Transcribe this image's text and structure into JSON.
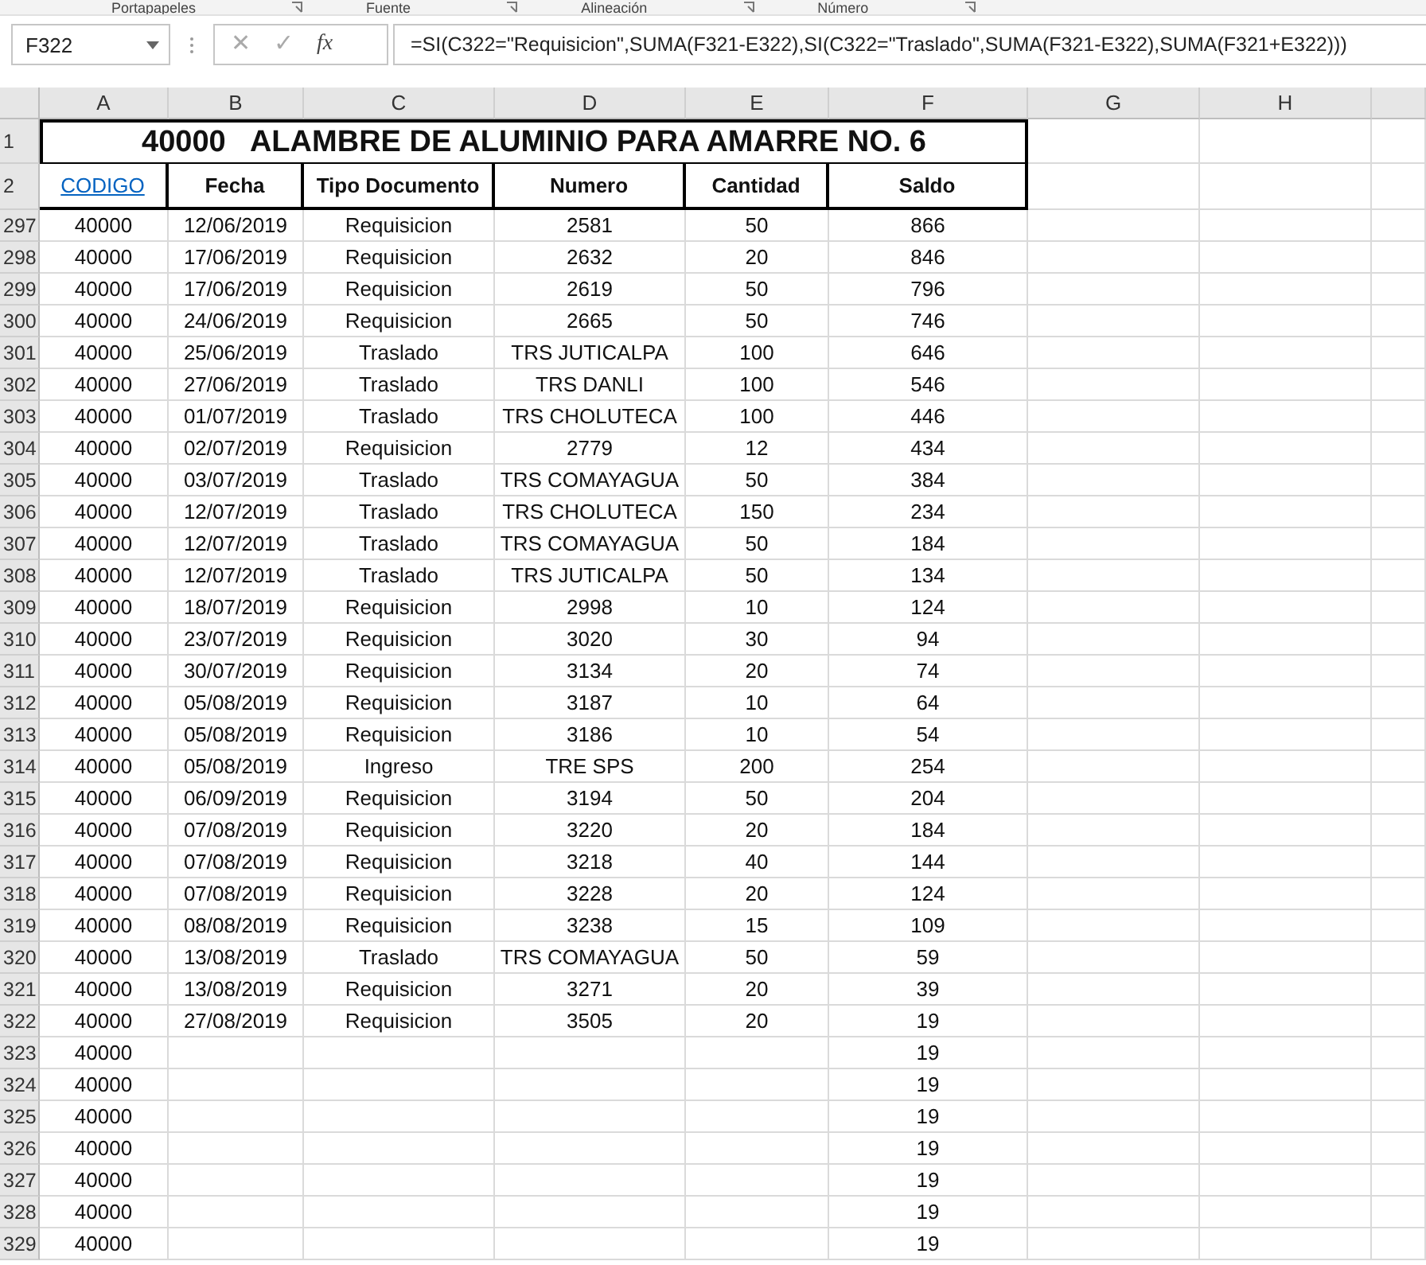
{
  "ribbon_groups": [
    "Portapapeles",
    "Fuente",
    "Alineación",
    "Número"
  ],
  "formula_bar": {
    "name_box": "F322",
    "cancel": "✕",
    "enter": "✓",
    "function": "fx",
    "formula": "=SI(C322=\"Requisicion\",SUMA(F321-E322),SI(C322=\"Traslado\",SUMA(F321-E322),SUMA(F321+E322)))"
  },
  "column_headers": [
    "A",
    "B",
    "C",
    "D",
    "E",
    "F",
    "G",
    "H"
  ],
  "title_row": {
    "row": "1",
    "title": "40000   ALAMBRE DE ALUMINIO PARA AMARRE NO. 6"
  },
  "header_row": {
    "row": "2",
    "columns": [
      {
        "label": "CODIGO",
        "kind": "link"
      },
      {
        "label": "Fecha",
        "kind": "header"
      },
      {
        "label": "Tipo Documento",
        "kind": "header"
      },
      {
        "label": "Numero",
        "kind": "header"
      },
      {
        "label": "Cantidad",
        "kind": "header"
      },
      {
        "label": "Saldo",
        "kind": "header"
      }
    ]
  },
  "rows": [
    {
      "row": "297",
      "codigo": "40000",
      "fecha": "12/06/2019",
      "tipo": "Requisicion",
      "numero": "2581",
      "cantidad": "50",
      "saldo": "866"
    },
    {
      "row": "298",
      "codigo": "40000",
      "fecha": "17/06/2019",
      "tipo": "Requisicion",
      "numero": "2632",
      "cantidad": "20",
      "saldo": "846"
    },
    {
      "row": "299",
      "codigo": "40000",
      "fecha": "17/06/2019",
      "tipo": "Requisicion",
      "numero": "2619",
      "cantidad": "50",
      "saldo": "796"
    },
    {
      "row": "300",
      "codigo": "40000",
      "fecha": "24/06/2019",
      "tipo": "Requisicion",
      "numero": "2665",
      "cantidad": "50",
      "saldo": "746"
    },
    {
      "row": "301",
      "codigo": "40000",
      "fecha": "25/06/2019",
      "tipo": "Traslado",
      "numero": "TRS JUTICALPA",
      "cantidad": "100",
      "saldo": "646"
    },
    {
      "row": "302",
      "codigo": "40000",
      "fecha": "27/06/2019",
      "tipo": "Traslado",
      "numero": "TRS DANLI",
      "cantidad": "100",
      "saldo": "546"
    },
    {
      "row": "303",
      "codigo": "40000",
      "fecha": "01/07/2019",
      "tipo": "Traslado",
      "numero": "TRS CHOLUTECA",
      "cantidad": "100",
      "saldo": "446"
    },
    {
      "row": "304",
      "codigo": "40000",
      "fecha": "02/07/2019",
      "tipo": "Requisicion",
      "numero": "2779",
      "cantidad": "12",
      "saldo": "434"
    },
    {
      "row": "305",
      "codigo": "40000",
      "fecha": "03/07/2019",
      "tipo": "Traslado",
      "numero": "TRS COMAYAGUA",
      "cantidad": "50",
      "saldo": "384"
    },
    {
      "row": "306",
      "codigo": "40000",
      "fecha": "12/07/2019",
      "tipo": "Traslado",
      "numero": "TRS CHOLUTECA",
      "cantidad": "150",
      "saldo": "234"
    },
    {
      "row": "307",
      "codigo": "40000",
      "fecha": "12/07/2019",
      "tipo": "Traslado",
      "numero": "TRS COMAYAGUA",
      "cantidad": "50",
      "saldo": "184"
    },
    {
      "row": "308",
      "codigo": "40000",
      "fecha": "12/07/2019",
      "tipo": "Traslado",
      "numero": "TRS JUTICALPA",
      "cantidad": "50",
      "saldo": "134"
    },
    {
      "row": "309",
      "codigo": "40000",
      "fecha": "18/07/2019",
      "tipo": "Requisicion",
      "numero": "2998",
      "cantidad": "10",
      "saldo": "124"
    },
    {
      "row": "310",
      "codigo": "40000",
      "fecha": "23/07/2019",
      "tipo": "Requisicion",
      "numero": "3020",
      "cantidad": "30",
      "saldo": "94"
    },
    {
      "row": "311",
      "codigo": "40000",
      "fecha": "30/07/2019",
      "tipo": "Requisicion",
      "numero": "3134",
      "cantidad": "20",
      "saldo": "74"
    },
    {
      "row": "312",
      "codigo": "40000",
      "fecha": "05/08/2019",
      "tipo": "Requisicion",
      "numero": "3187",
      "cantidad": "10",
      "saldo": "64"
    },
    {
      "row": "313",
      "codigo": "40000",
      "fecha": "05/08/2019",
      "tipo": "Requisicion",
      "numero": "3186",
      "cantidad": "10",
      "saldo": "54"
    },
    {
      "row": "314",
      "codigo": "40000",
      "fecha": "05/08/2019",
      "tipo": "Ingreso",
      "numero": "TRE SPS",
      "cantidad": "200",
      "saldo": "254"
    },
    {
      "row": "315",
      "codigo": "40000",
      "fecha": "06/09/2019",
      "tipo": "Requisicion",
      "numero": "3194",
      "cantidad": "50",
      "saldo": "204"
    },
    {
      "row": "316",
      "codigo": "40000",
      "fecha": "07/08/2019",
      "tipo": "Requisicion",
      "numero": "3220",
      "cantidad": "20",
      "saldo": "184"
    },
    {
      "row": "317",
      "codigo": "40000",
      "fecha": "07/08/2019",
      "tipo": "Requisicion",
      "numero": "3218",
      "cantidad": "40",
      "saldo": "144"
    },
    {
      "row": "318",
      "codigo": "40000",
      "fecha": "07/08/2019",
      "tipo": "Requisicion",
      "numero": "3228",
      "cantidad": "20",
      "saldo": "124"
    },
    {
      "row": "319",
      "codigo": "40000",
      "fecha": "08/08/2019",
      "tipo": "Requisicion",
      "numero": "3238",
      "cantidad": "15",
      "saldo": "109"
    },
    {
      "row": "320",
      "codigo": "40000",
      "fecha": "13/08/2019",
      "tipo": "Traslado",
      "numero": "TRS COMAYAGUA",
      "cantidad": "50",
      "saldo": "59"
    },
    {
      "row": "321",
      "codigo": "40000",
      "fecha": "13/08/2019",
      "tipo": "Requisicion",
      "numero": "3271",
      "cantidad": "20",
      "saldo": "39"
    },
    {
      "row": "322",
      "codigo": "40000",
      "fecha": "27/08/2019",
      "tipo": "Requisicion",
      "numero": "3505",
      "cantidad": "20",
      "saldo": "19"
    },
    {
      "row": "323",
      "codigo": "40000",
      "saldo": "19"
    },
    {
      "row": "324",
      "codigo": "40000",
      "saldo": "19"
    },
    {
      "row": "325",
      "codigo": "40000",
      "saldo": "19"
    },
    {
      "row": "326",
      "codigo": "40000",
      "saldo": "19"
    },
    {
      "row": "327",
      "codigo": "40000",
      "saldo": "19"
    },
    {
      "row": "328",
      "codigo": "40000",
      "saldo": "19"
    },
    {
      "row": "329",
      "codigo": "40000",
      "saldo": "19"
    }
  ]
}
